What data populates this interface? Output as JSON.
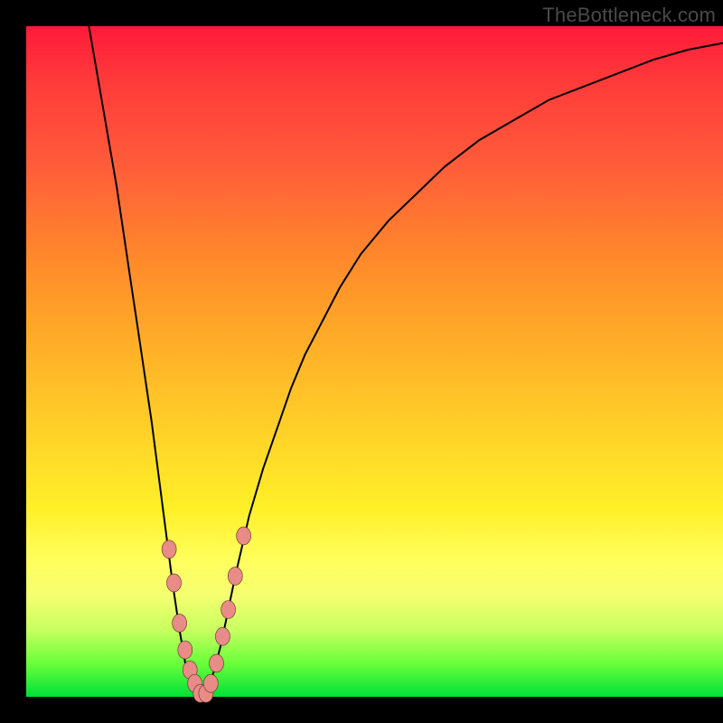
{
  "watermark": "TheBottleneck.com",
  "colors": {
    "curve": "#000000",
    "dot_fill": "#e98b86",
    "dot_stroke": "#5a2f2a",
    "frame": "#000000"
  },
  "chart_data": {
    "type": "line",
    "title": "",
    "xlabel": "",
    "ylabel": "",
    "xlim": [
      0,
      100
    ],
    "ylim": [
      0,
      100
    ],
    "series": [
      {
        "name": "bottleneck-curve",
        "x": [
          9,
          10,
          11,
          12,
          13,
          14,
          15,
          16,
          17,
          18,
          19,
          20,
          21,
          22,
          23,
          24,
          25,
          26,
          27,
          28,
          29,
          30,
          32,
          34,
          36,
          38,
          40,
          42,
          45,
          48,
          52,
          56,
          60,
          65,
          70,
          75,
          80,
          85,
          90,
          95,
          100
        ],
        "values": [
          100,
          94,
          88,
          82,
          76,
          69,
          62,
          55,
          48,
          41,
          33,
          25,
          17,
          10,
          4,
          1,
          0,
          1,
          4,
          8,
          13,
          18,
          27,
          34,
          40,
          46,
          51,
          55,
          61,
          66,
          71,
          75,
          79,
          83,
          86,
          89,
          91,
          93,
          95,
          96.5,
          97.5
        ]
      }
    ],
    "scatter_overlay": {
      "name": "highlighted-points",
      "points": [
        {
          "x": 20.5,
          "y": 22
        },
        {
          "x": 21.2,
          "y": 17
        },
        {
          "x": 22.0,
          "y": 11
        },
        {
          "x": 22.8,
          "y": 7
        },
        {
          "x": 23.5,
          "y": 4
        },
        {
          "x": 24.2,
          "y": 2
        },
        {
          "x": 25.0,
          "y": 0.5
        },
        {
          "x": 25.8,
          "y": 0.5
        },
        {
          "x": 26.5,
          "y": 2
        },
        {
          "x": 27.3,
          "y": 5
        },
        {
          "x": 28.2,
          "y": 9
        },
        {
          "x": 29.0,
          "y": 13
        },
        {
          "x": 30.0,
          "y": 18
        },
        {
          "x": 31.2,
          "y": 24
        }
      ]
    }
  }
}
